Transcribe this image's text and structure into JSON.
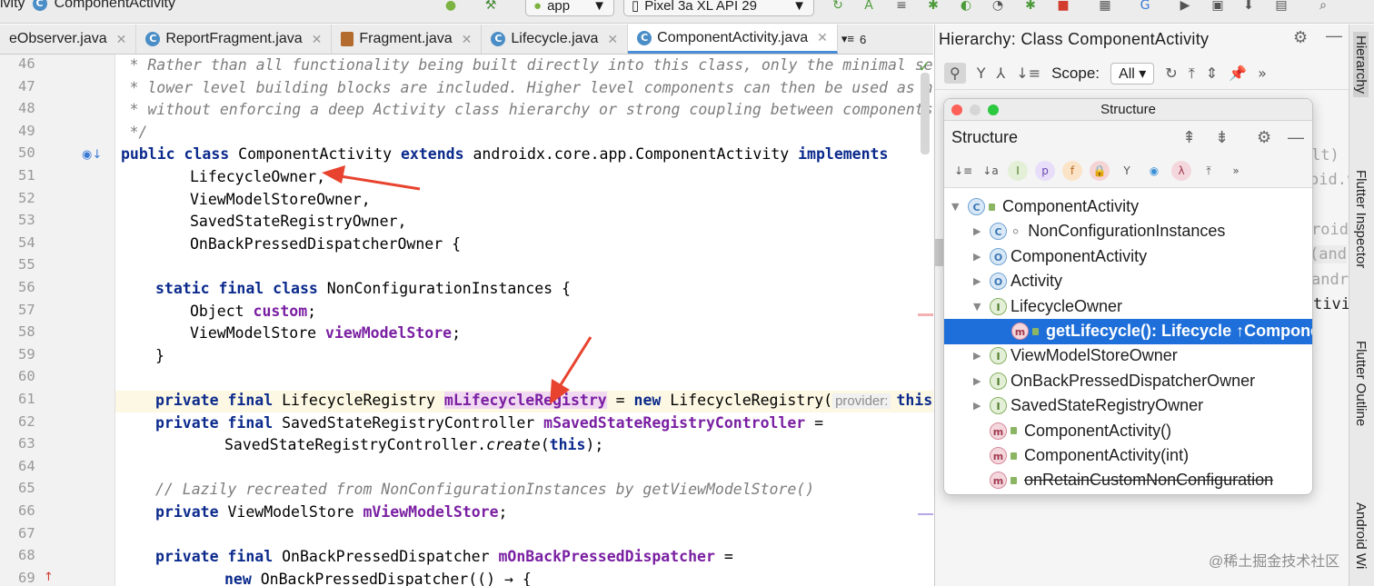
{
  "topbar": {
    "crumb_text": "ivity",
    "crumb_class": "ComponentActivity",
    "run_config": "app",
    "device": "Pixel 3a XL API 29"
  },
  "tabs": [
    {
      "label": "eObserver.java",
      "icon": "class-icon",
      "active": false
    },
    {
      "label": "ReportFragment.java",
      "icon": "class-icon",
      "active": false
    },
    {
      "label": "Fragment.java",
      "icon": "java-file-icon",
      "active": false
    },
    {
      "label": "Lifecycle.java",
      "icon": "class-icon",
      "active": false
    },
    {
      "label": "ComponentActivity.java",
      "icon": "class-icon",
      "active": true
    }
  ],
  "tabs_overflow": "6",
  "code_lines": [
    {
      "n": "46",
      "text": "* Rather than all functionality being built directly into this class, only the minimal set"
    },
    {
      "n": "47",
      "text": "* lower level building blocks are included. Higher level components can then be used as neede"
    },
    {
      "n": "48",
      "text": "* without enforcing a deep Activity class hierarchy or strong coupling between components."
    },
    {
      "n": "49",
      "text": "*/"
    },
    {
      "n": "50",
      "k1": "public class",
      "t1": " ComponentActivity ",
      "k2": "extends",
      "t2": " androidx.core.app.ComponentActivity ",
      "k3": "implements"
    },
    {
      "n": "51",
      "text": "LifecycleOwner,"
    },
    {
      "n": "52",
      "text": "ViewModelStoreOwner,"
    },
    {
      "n": "53",
      "text": "SavedStateRegistryOwner,"
    },
    {
      "n": "54",
      "text": "OnBackPressedDispatcherOwner {"
    },
    {
      "n": "55",
      "text": ""
    },
    {
      "n": "56",
      "k1": "static final class",
      "t1": " NonConfigurationInstances {"
    },
    {
      "n": "57",
      "t1": "Object ",
      "f1": "custom",
      "t2": ";"
    },
    {
      "n": "58",
      "t1": "ViewModelStore ",
      "f1": "viewModelStore",
      "t2": ";"
    },
    {
      "n": "59",
      "text": "}"
    },
    {
      "n": "60",
      "text": ""
    },
    {
      "n": "61",
      "k1": "private final",
      "t1": " LifecycleRegistry ",
      "f1": "mLifecycleRegistry",
      "t2": " = ",
      "k2": "new",
      "t3": " LifecycleRegistry(",
      "hint": "provider:",
      "k3": "this",
      "t4": ")"
    },
    {
      "n": "62",
      "k1": "private final",
      "t1": " SavedStateRegistryController ",
      "f1": "mSavedStateRegistryController",
      "t2": " ="
    },
    {
      "n": "63",
      "t1": "SavedStateRegistryController.",
      "i1": "create",
      "t2": "(",
      "k1": "this",
      "t3": ");"
    },
    {
      "n": "64",
      "text": ""
    },
    {
      "n": "65",
      "text": "// Lazily recreated from NonConfigurationInstances by getViewModelStore()"
    },
    {
      "n": "66",
      "k1": "private",
      "t1": " ViewModelStore ",
      "f1": "mViewModelStore",
      "t2": ";"
    },
    {
      "n": "67",
      "text": ""
    },
    {
      "n": "68",
      "k1": "private final",
      "t1": " OnBackPressedDispatcher ",
      "f1": "mOnBackPressedDispatcher",
      "t2": " ="
    },
    {
      "n": "69",
      "k1": "new",
      "t1": " OnBackPressedDispatcher(() → {"
    }
  ],
  "hierarchy": {
    "title": "Hierarchy:  Class ComponentActivity",
    "scope_label": "Scope:",
    "scope_value": "All",
    "ghost_lines": [
      "lt)",
      "oid.v",
      "roid:",
      "(and",
      "andr",
      "tivity"
    ]
  },
  "structure": {
    "window_title": "Structure",
    "panel_title": "Structure",
    "nodes": [
      {
        "label": "ComponentActivity",
        "icon": "c",
        "arrow": "▼",
        "depth": 0
      },
      {
        "label": "NonConfigurationInstances",
        "icon": "c",
        "arrow": "▶",
        "depth": 1
      },
      {
        "label": "ComponentActivity",
        "icon": "o",
        "arrow": "▶",
        "depth": 1
      },
      {
        "label": "Activity",
        "icon": "o",
        "arrow": "▶",
        "depth": 1
      },
      {
        "label": "LifecycleOwner",
        "icon": "i",
        "arrow": "▼",
        "depth": 1
      },
      {
        "label": "getLifecycle(): Lifecycle ↑ComponentA",
        "icon": "m",
        "arrow": "",
        "depth": 2
      },
      {
        "label": "ViewModelStoreOwner",
        "icon": "i",
        "arrow": "▶",
        "depth": 1
      },
      {
        "label": "OnBackPressedDispatcherOwner",
        "icon": "i",
        "arrow": "▶",
        "depth": 1
      },
      {
        "label": "SavedStateRegistryOwner",
        "icon": "i",
        "arrow": "▶",
        "depth": 1
      },
      {
        "label": "ComponentActivity()",
        "icon": "m",
        "arrow": "",
        "depth": 1
      },
      {
        "label": "ComponentActivity(int)",
        "icon": "m",
        "arrow": "",
        "depth": 1
      },
      {
        "label": "onRetainCustomNonConfiguration",
        "icon": "m",
        "arrow": "",
        "depth": 1
      }
    ]
  },
  "right_strip": {
    "tabs": [
      "Hierarchy",
      "Flutter Inspector",
      "Flutter Outline",
      "Android Wi"
    ]
  },
  "watermark": "@稀土掘金技术社区",
  "colors": {
    "accent": "#1e6fd9",
    "annotation_arrow": "#e8432e",
    "keyword": "#0b2a8c",
    "field": "#7a1fa2"
  }
}
